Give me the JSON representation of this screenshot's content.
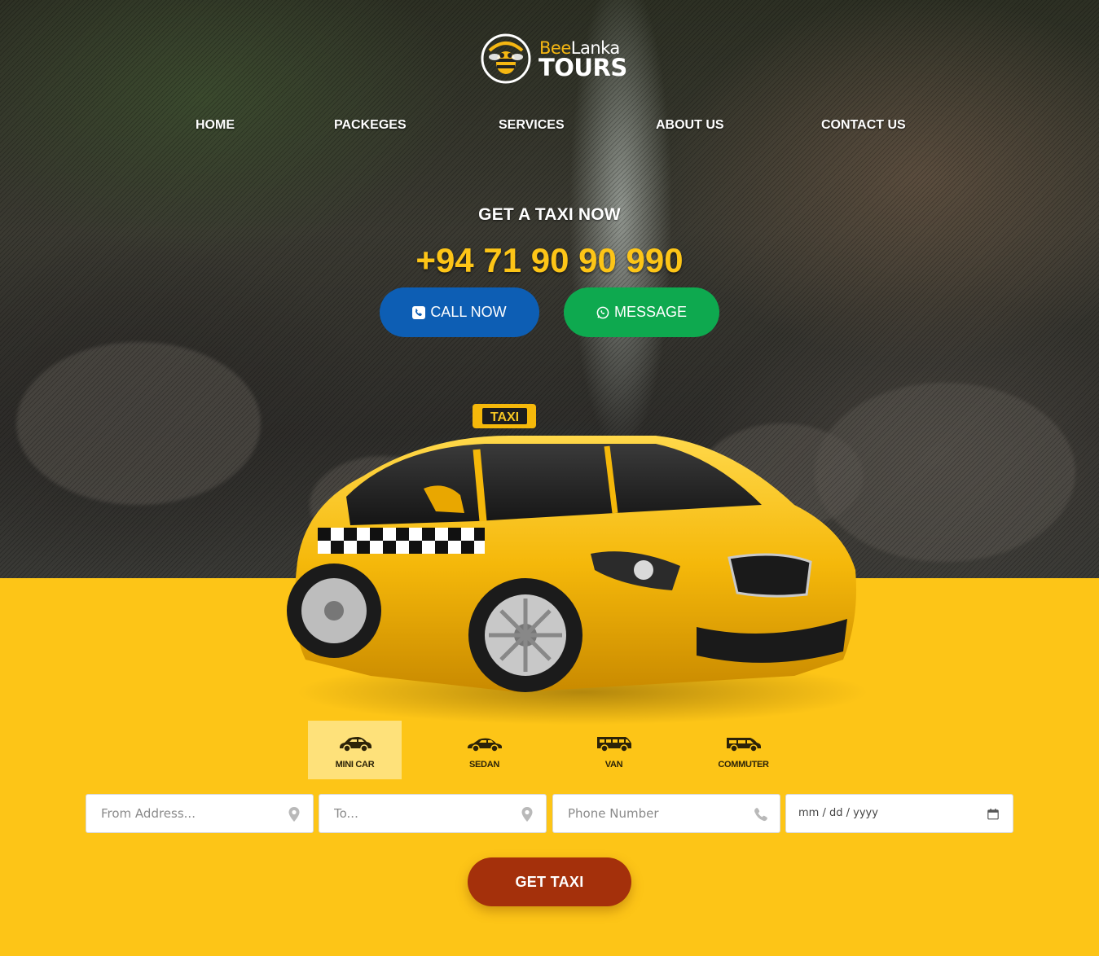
{
  "brand": {
    "logo_line1_a": "Bee",
    "logo_line1_b": "Lanka",
    "logo_line2": "TOURS",
    "logo_icon": "bee-icon"
  },
  "nav": {
    "items": [
      {
        "label": "HOME"
      },
      {
        "label": "PACKEGES"
      },
      {
        "label": "SERVICES"
      },
      {
        "label": "ABOUT US"
      },
      {
        "label": "CONTACT US"
      }
    ]
  },
  "cta": {
    "title": "GET A TAXI NOW",
    "phone": "+94 71 90 90 990",
    "call_label": "CALL NOW",
    "call_icon": "phone-square-icon",
    "message_label": "MESSAGE",
    "message_icon": "whatsapp-icon",
    "call_color": "#0d5eb4",
    "message_color": "#0ea94f"
  },
  "car": {
    "roof_sign": "TAXI"
  },
  "vehicle_types": [
    {
      "label": "MINI CAR",
      "icon": "mini-car-icon",
      "selected": true
    },
    {
      "label": "SEDAN",
      "icon": "sedan-icon",
      "selected": false
    },
    {
      "label": "VAN",
      "icon": "van-icon",
      "selected": false
    },
    {
      "label": "COMMUTER",
      "icon": "commuter-icon",
      "selected": false
    }
  ],
  "form": {
    "from_placeholder": "From Address...",
    "to_placeholder": "To...",
    "phone_placeholder": "Phone Number",
    "date_placeholder": "mm / dd / yyyy",
    "submit_label": "GET TAXI"
  },
  "colors": {
    "accent": "#fdc517",
    "submit": "#a4300b",
    "selected_tab": "#fee17a"
  }
}
